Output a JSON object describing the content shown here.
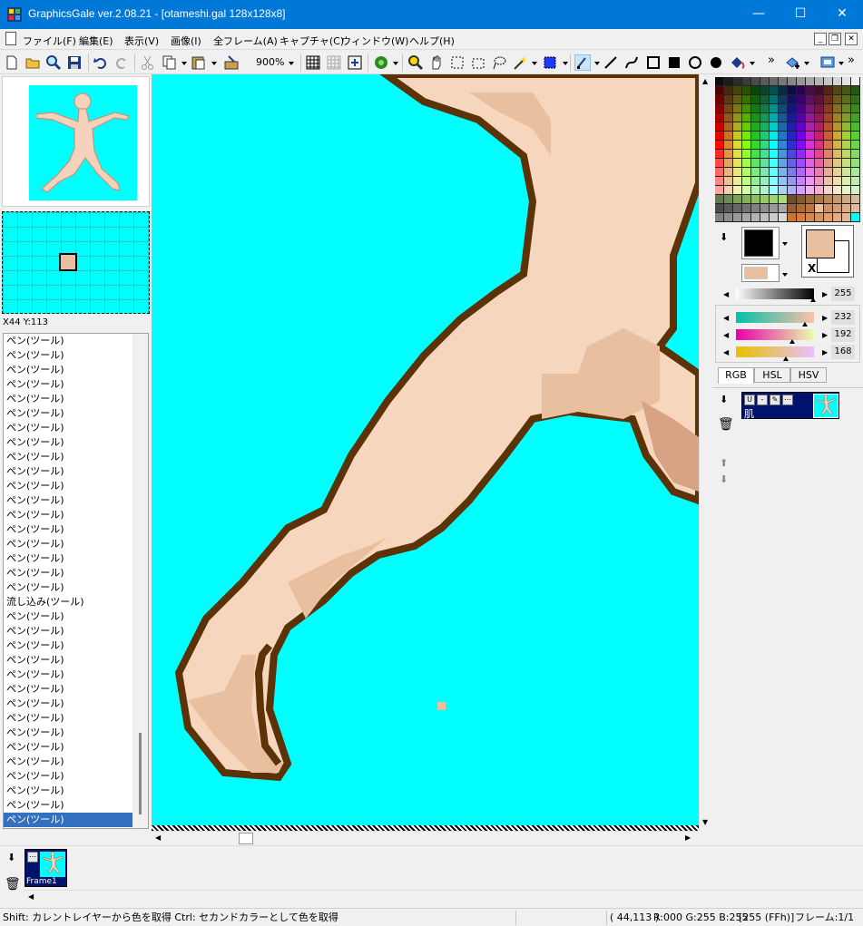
{
  "window": {
    "title": "GraphicsGale ver.2.08.21 - [otameshi.gal 128x128x8]",
    "minimize": "—",
    "maximize": "☐",
    "close": "✕"
  },
  "menu": {
    "items": [
      "ファイル(F)",
      "編集(E)",
      "表示(V)",
      "画像(I)",
      "全フレーム(A)",
      "キャプチャ(C)",
      "ウィンドウ(W)",
      "ヘルプ(H)"
    ],
    "mdi_buttons": [
      "_",
      "❐",
      "✕"
    ]
  },
  "toolbar": {
    "zoom": "900%",
    "overflow": "»"
  },
  "navigator": {
    "coords": "X44 Y:113"
  },
  "history": {
    "items": [
      "ペン(ツール)",
      "ペン(ツール)",
      "ペン(ツール)",
      "ペン(ツール)",
      "ペン(ツール)",
      "ペン(ツール)",
      "ペン(ツール)",
      "ペン(ツール)",
      "ペン(ツール)",
      "ペン(ツール)",
      "ペン(ツール)",
      "ペン(ツール)",
      "ペン(ツール)",
      "ペン(ツール)",
      "ペン(ツール)",
      "ペン(ツール)",
      "ペン(ツール)",
      "ペン(ツール)",
      "流し込み(ツール)",
      "ペン(ツール)",
      "ペン(ツール)",
      "ペン(ツール)",
      "ペン(ツール)",
      "ペン(ツール)",
      "ペン(ツール)",
      "ペン(ツール)",
      "ペン(ツール)",
      "ペン(ツール)",
      "ペン(ツール)",
      "ペン(ツール)",
      "ペン(ツール)",
      "ペン(ツール)",
      "ペン(ツール)"
    ],
    "selected": "ペン(ツール)"
  },
  "color": {
    "primary": "#e8bf9f",
    "background": "#00ffff",
    "outline": "#5c3208",
    "gray_value": "255",
    "r_value": "232",
    "g_value": "192",
    "b_value": "168",
    "x_label": "X"
  },
  "color_tabs": [
    "RGB",
    "HSL",
    "HSV"
  ],
  "layer": {
    "name": "肌"
  },
  "frame": {
    "label": "Frame1"
  },
  "status": {
    "hint": "Shift: カレントレイヤーから色を取得  Ctrl: セカンドカラーとして色を取得",
    "pos": "( 44,113 )",
    "rgb": "R:000 G:255 B:255",
    "index": "[255 (FFh)]",
    "frame": "フレーム:1/1"
  }
}
